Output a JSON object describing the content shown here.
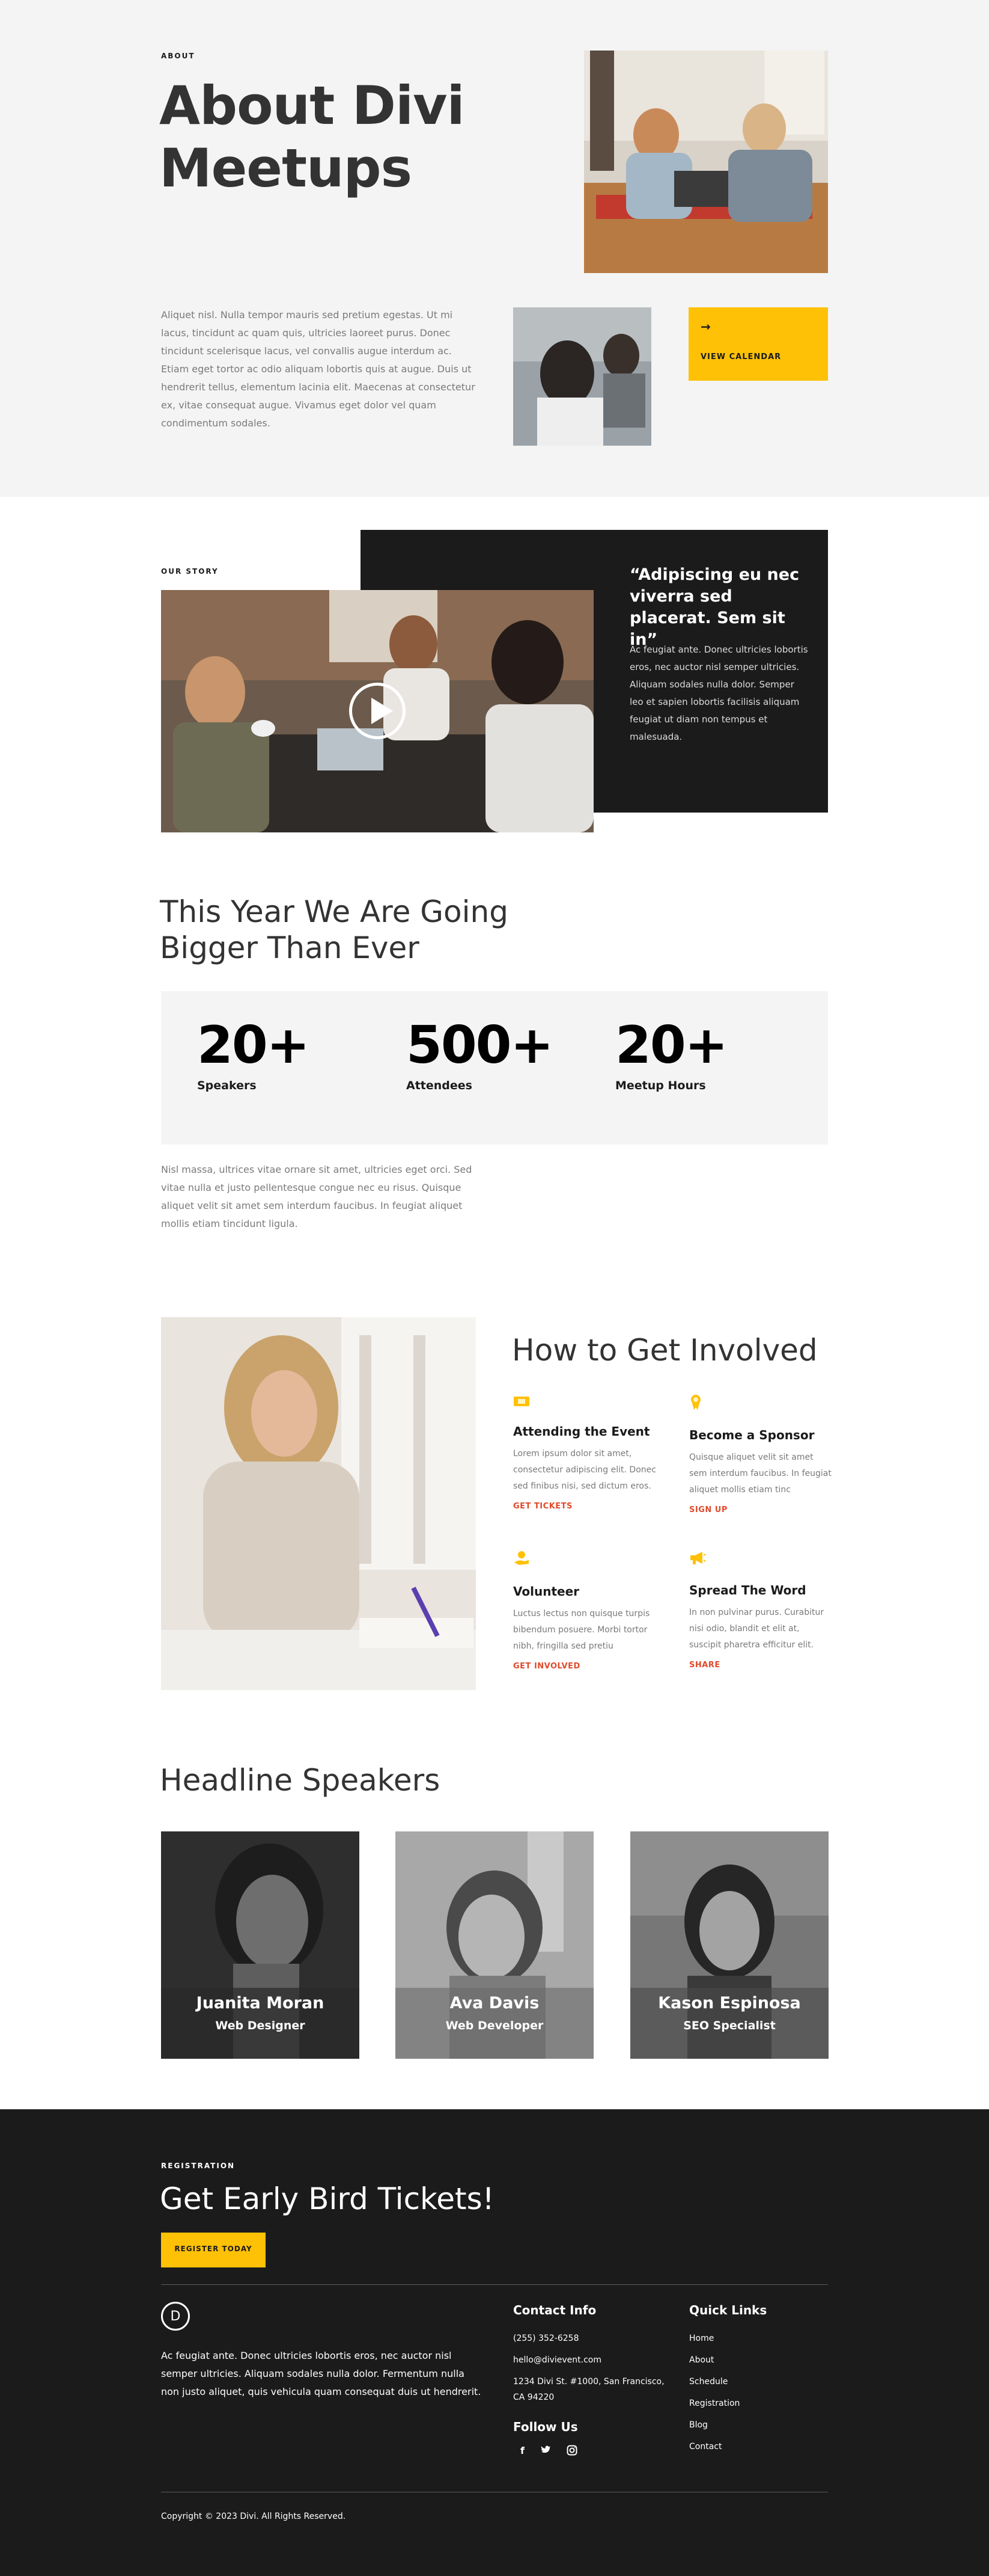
{
  "colors": {
    "accent": "#ffc106",
    "dark": "#1b1b1b",
    "light_bg": "#f4f4f4",
    "link": "#e04a2a"
  },
  "about": {
    "eyebrow": "ABOUT",
    "title_line1": "About Divi",
    "title_line2": "Meetups",
    "body": "Aliquet nisl. Nulla tempor mauris sed pretium egestas. Ut mi lacus, tincidunt ac quam quis, ultricies laoreet purus. Donec tincidunt scelerisque lacus, vel convallis augue interdum ac. Etiam eget tortor ac odio aliquam lobortis quis at augue. Duis ut hendrerit tellus, elementum lacinia elit. Maecenas at consectetur ex, vitae consequat augue. Vivamus eget dolor vel quam condimentum sodales.",
    "cta_icon": "arrow-right-icon",
    "cta_label": "VIEW CALENDAR"
  },
  "story": {
    "eyebrow": "OUR STORY",
    "quote": "“Adipiscing eu nec viverra sed placerat. Sem sit in”",
    "text": "Ac feugiat ante. Donec ultricies lobortis eros, nec auctor nisl semper ultricies. Aliquam sodales nulla dolor. Semper leo et sapien lobortis facilisis aliquam feugiat ut diam non tempus et malesuada.",
    "play_icon": "play-icon"
  },
  "growth": {
    "title_line1": "This Year We Are Going",
    "title_line2": "Bigger Than Ever",
    "stats": [
      {
        "number": "20+",
        "label": "Speakers"
      },
      {
        "number": "500+",
        "label": "Attendees"
      },
      {
        "number": "20+",
        "label": "Meetup Hours"
      }
    ],
    "body": "Nisl massa, ultrices vitae ornare sit amet, ultricies eget orci. Sed vitae nulla et justo pellentesque congue nec eu risus. Quisque aliquet velit sit amet sem interdum faucibus. In feugiat aliquet mollis etiam tincidunt ligula."
  },
  "involved": {
    "title": "How to Get Involved",
    "items": [
      {
        "icon": "ticket-icon",
        "title": "Attending the Event",
        "text": "Lorem ipsum dolor sit amet, consectetur adipiscing elit. Donec sed finibus nisi, sed dictum eros.",
        "link": "GET TICKETS"
      },
      {
        "icon": "award-icon",
        "title": "Become a Sponsor",
        "text": "Quisque aliquet velit sit amet sem interdum faucibus. In feugiat aliquet mollis etiam tinc",
        "link": "SIGN UP"
      },
      {
        "icon": "volunteer-icon",
        "title": "Volunteer",
        "text": "Luctus lectus non quisque turpis bibendum posuere. Morbi tortor nibh, fringilla sed pretiu",
        "link": "GET INVOLVED"
      },
      {
        "icon": "megaphone-icon",
        "title": "Spread The Word",
        "text": "In non pulvinar purus. Curabitur nisi odio, blandit et elit at, suscipit pharetra efficitur elit.",
        "link": "SHARE"
      }
    ]
  },
  "speakers": {
    "title": "Headline Speakers",
    "cards": [
      {
        "name": "Juanita Moran",
        "role": "Web Designer"
      },
      {
        "name": "Ava Davis",
        "role": "Web Developer"
      },
      {
        "name": "Kason Espinosa",
        "role": "SEO Specialist"
      }
    ]
  },
  "footer": {
    "eyebrow": "REGISTRATION",
    "title": "Get Early Bird Tickets!",
    "register_label": "REGISTER TODAY",
    "logo_letter": "D",
    "about": "Ac feugiat ante. Donec ultricies lobortis eros, nec auctor nisl semper ultricies. Aliquam sodales nulla dolor. Fermentum nulla non justo aliquet, quis vehicula quam consequat duis ut hendrerit.",
    "contact_title": "Contact Info",
    "phone": "(255) 352-6258",
    "email": "hello@divievent.com",
    "address": "1234 Divi St. #1000, San Francisco, CA 94220",
    "follow_title": "Follow Us",
    "social": [
      "facebook-icon",
      "twitter-icon",
      "instagram-icon"
    ],
    "links_title": "Quick Links",
    "links": [
      "Home",
      "About",
      "Schedule",
      "Registration",
      "Blog",
      "Contact"
    ],
    "copyright": "Copyright © 2023 Divi. All Rights Reserved."
  }
}
